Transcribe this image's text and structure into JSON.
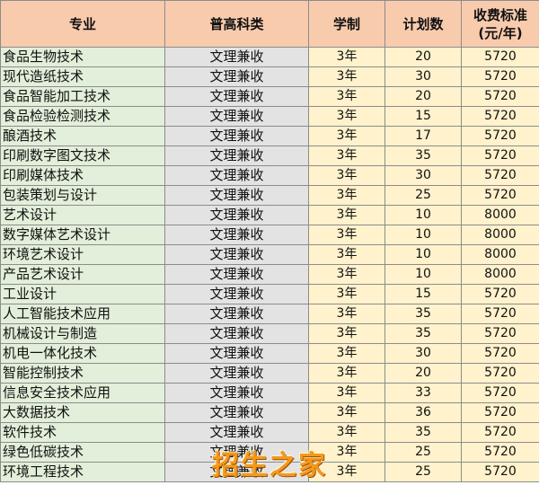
{
  "table": {
    "headers": {
      "major": "专业",
      "subject": "普高科类",
      "years": "学制",
      "plan": "计划数",
      "fee_line1": "收费标准",
      "fee_line2": "(元/年)"
    },
    "rows": [
      {
        "major": "食品生物技术",
        "subject": "文理兼收",
        "years": "3年",
        "plan": "20",
        "fee": "5720"
      },
      {
        "major": "现代造纸技术",
        "subject": "文理兼收",
        "years": "3年",
        "plan": "30",
        "fee": "5720"
      },
      {
        "major": "食品智能加工技术",
        "subject": "文理兼收",
        "years": "3年",
        "plan": "20",
        "fee": "5720"
      },
      {
        "major": "食品检验检测技术",
        "subject": "文理兼收",
        "years": "3年",
        "plan": "15",
        "fee": "5720"
      },
      {
        "major": "酿酒技术",
        "subject": "文理兼收",
        "years": "3年",
        "plan": "17",
        "fee": "5720"
      },
      {
        "major": "印刷数字图文技术",
        "subject": "文理兼收",
        "years": "3年",
        "plan": "35",
        "fee": "5720"
      },
      {
        "major": "印刷媒体技术",
        "subject": "文理兼收",
        "years": "3年",
        "plan": "30",
        "fee": "5720"
      },
      {
        "major": "包装策划与设计",
        "subject": "文理兼收",
        "years": "3年",
        "plan": "25",
        "fee": "5720"
      },
      {
        "major": "艺术设计",
        "subject": "文理兼收",
        "years": "3年",
        "plan": "10",
        "fee": "8000"
      },
      {
        "major": "数字媒体艺术设计",
        "subject": "文理兼收",
        "years": "3年",
        "plan": "10",
        "fee": "8000"
      },
      {
        "major": "环境艺术设计",
        "subject": "文理兼收",
        "years": "3年",
        "plan": "10",
        "fee": "8000"
      },
      {
        "major": "产品艺术设计",
        "subject": "文理兼收",
        "years": "3年",
        "plan": "10",
        "fee": "8000"
      },
      {
        "major": "工业设计",
        "subject": "文理兼收",
        "years": "3年",
        "plan": "15",
        "fee": "5720"
      },
      {
        "major": "人工智能技术应用",
        "subject": "文理兼收",
        "years": "3年",
        "plan": "35",
        "fee": "5720"
      },
      {
        "major": "机械设计与制造",
        "subject": "文理兼收",
        "years": "3年",
        "plan": "35",
        "fee": "5720"
      },
      {
        "major": "机电一体化技术",
        "subject": "文理兼收",
        "years": "3年",
        "plan": "30",
        "fee": "5720"
      },
      {
        "major": "智能控制技术",
        "subject": "文理兼收",
        "years": "3年",
        "plan": "20",
        "fee": "5720"
      },
      {
        "major": "信息安全技术应用",
        "subject": "文理兼收",
        "years": "3年",
        "plan": "33",
        "fee": "5720"
      },
      {
        "major": "大数据技术",
        "subject": "文理兼收",
        "years": "3年",
        "plan": "36",
        "fee": "5720"
      },
      {
        "major": "软件技术",
        "subject": "文理兼收",
        "years": "3年",
        "plan": "35",
        "fee": "5720"
      },
      {
        "major": "绿色低碳技术",
        "subject": "文理兼收",
        "years": "3年",
        "plan": "25",
        "fee": "5720"
      },
      {
        "major": "环境工程技术",
        "subject": "文理兼收",
        "years": "3年",
        "plan": "25",
        "fee": "5720"
      }
    ]
  },
  "watermark": {
    "text": "招生之家"
  },
  "colors": {
    "header_bg": "#f8cbad",
    "major_bg": "#e2efda",
    "subject_bg": "#e3e3e3",
    "value_bg": "#fff2cc",
    "grid": "#8c8c8c",
    "watermark": "#f39a1c"
  }
}
